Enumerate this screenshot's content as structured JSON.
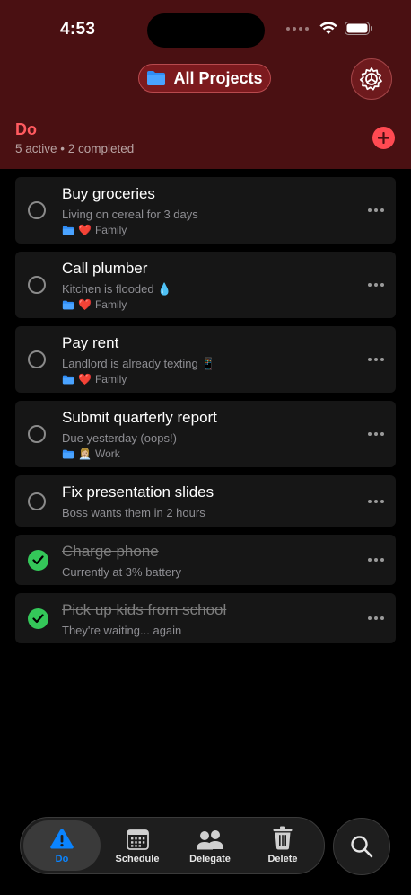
{
  "status": {
    "time": "4:53"
  },
  "header": {
    "project_label": "All Projects"
  },
  "section": {
    "title": "Do",
    "subtitle": "5 active • 2 completed"
  },
  "tasks": [
    {
      "title": "Buy groceries",
      "note": "Living on cereal for 3 days",
      "tag_emoji": "❤️",
      "tag": "Family",
      "completed": false
    },
    {
      "title": "Call plumber",
      "note": "Kitchen is flooded 💧",
      "tag_emoji": "❤️",
      "tag": "Family",
      "completed": false
    },
    {
      "title": "Pay rent",
      "note": "Landlord is already texting 📱",
      "tag_emoji": "❤️",
      "tag": "Family",
      "completed": false
    },
    {
      "title": "Submit quarterly report",
      "note": "Due yesterday (oops!)",
      "tag_emoji": "👩🏼‍💼",
      "tag": "Work",
      "completed": false
    },
    {
      "title": "Fix presentation slides",
      "note": "Boss wants them in 2 hours",
      "completed": false
    },
    {
      "title": "Charge phone",
      "note": "Currently at 3% battery",
      "completed": true
    },
    {
      "title": "Pick up kids from school",
      "note": "They're waiting... again",
      "completed": true
    }
  ],
  "tabbar": {
    "items": [
      {
        "label": "Do",
        "icon": "warning-icon",
        "active": true
      },
      {
        "label": "Schedule",
        "icon": "calendar-icon",
        "active": false
      },
      {
        "label": "Delegate",
        "icon": "people-icon",
        "active": false
      },
      {
        "label": "Delete",
        "icon": "trash-icon",
        "active": false
      }
    ]
  },
  "colors": {
    "header_bg": "#4a1012",
    "accent": "#ff5a5f",
    "active_tab": "#0a84ff",
    "done_check": "#34c759"
  }
}
